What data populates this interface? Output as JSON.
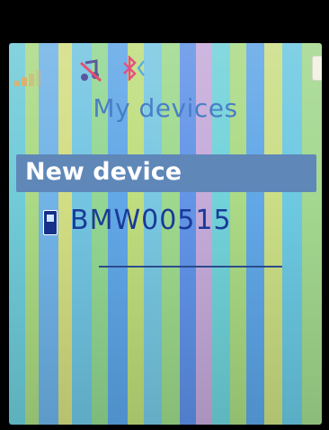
{
  "status_bar": {
    "icons": [
      "signal-strength-icon",
      "music-muted-icon",
      "bluetooth-icon",
      "battery-icon"
    ]
  },
  "header": {
    "title": "My devices"
  },
  "list": {
    "selected_item": "New device",
    "devices": [
      {
        "name": "BMW00515",
        "icon": "phone-icon"
      }
    ]
  },
  "colors": {
    "title": "#2f6cc0",
    "highlight": "#5f87b8",
    "device_text": "#1a3a9a"
  }
}
